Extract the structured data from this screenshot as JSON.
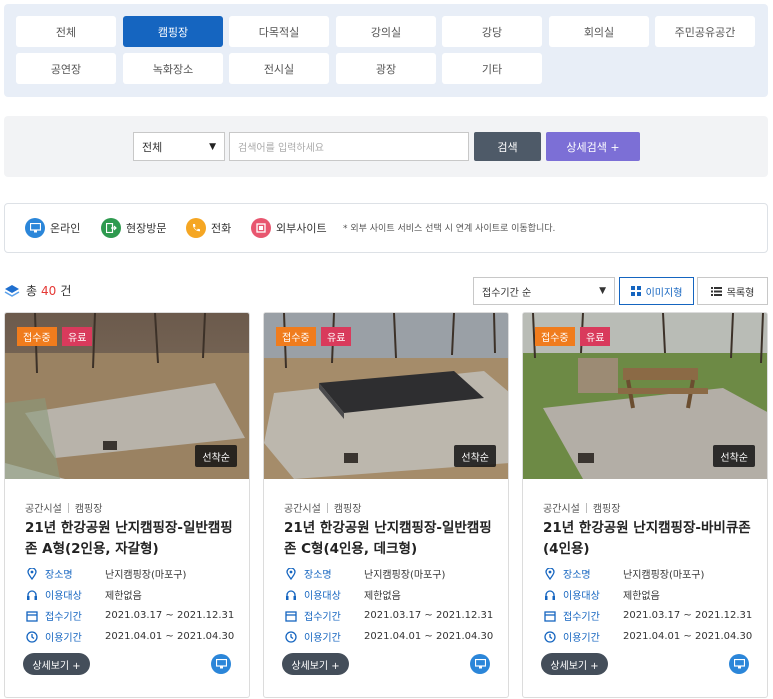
{
  "categories": [
    "전체",
    "캠핑장",
    "다목적실",
    "강의실",
    "강당",
    "회의실",
    "주민공유공간",
    "공연장",
    "녹화장소",
    "전시실",
    "광장",
    "기타"
  ],
  "active_category": "캠핑장",
  "search": {
    "scope_selected": "전체",
    "placeholder": "검색어를 입력하세요",
    "search_label": "검색",
    "advanced_label": "상세검색 +"
  },
  "legend": {
    "items": [
      {
        "label": "온라인",
        "color": "#2b86d9",
        "icon": "monitor-icon"
      },
      {
        "label": "현장방문",
        "color": "#2e9a4f",
        "icon": "door-exit-icon"
      },
      {
        "label": "전화",
        "color": "#f5a623",
        "icon": "phone-icon"
      },
      {
        "label": "외부사이트",
        "color": "#e8566f",
        "icon": "external-site-icon"
      }
    ],
    "note": "* 외부 사이트 서비스 선택 시 연계 사이트로 이동합니다."
  },
  "results": {
    "total_prefix": "총",
    "total_count": "40",
    "total_suffix": "건",
    "sort_selected": "접수기간 순",
    "view_image_label": "이미지형",
    "view_list_label": "목록형"
  },
  "card_labels": {
    "place": "장소명",
    "target": "이용대상",
    "reception": "접수기간",
    "usage": "이용기간",
    "detail": "상세보기 +"
  },
  "cards": [
    {
      "status": "접수중",
      "fee": "유료",
      "selection": "선착순",
      "category1": "공간시설",
      "category2": "캠핑장",
      "title": "21년 한강공원 난지캠핑장-일반캠핑존 A형(2인용, 자갈형)",
      "place": "난지캠핑장(마포구)",
      "target": "제한없음",
      "reception": "2021.03.17 ~ 2021.12.31",
      "usage": "2021.04.01 ~ 2021.04.30"
    },
    {
      "status": "접수중",
      "fee": "유료",
      "selection": "선착순",
      "category1": "공간시설",
      "category2": "캠핑장",
      "title": "21년 한강공원 난지캠핑장-일반캠핑존 C형(4인용, 데크형)",
      "place": "난지캠핑장(마포구)",
      "target": "제한없음",
      "reception": "2021.03.17 ~ 2021.12.31",
      "usage": "2021.04.01 ~ 2021.04.30"
    },
    {
      "status": "접수중",
      "fee": "유료",
      "selection": "선착순",
      "category1": "공간시설",
      "category2": "캠핑장",
      "title": "21년 한강공원 난지캠핑장-바비큐존(4인용)",
      "place": "난지캠핑장(마포구)",
      "target": "제한없음",
      "reception": "2021.03.17 ~ 2021.12.31",
      "usage": "2021.04.01 ~ 2021.04.30"
    }
  ]
}
